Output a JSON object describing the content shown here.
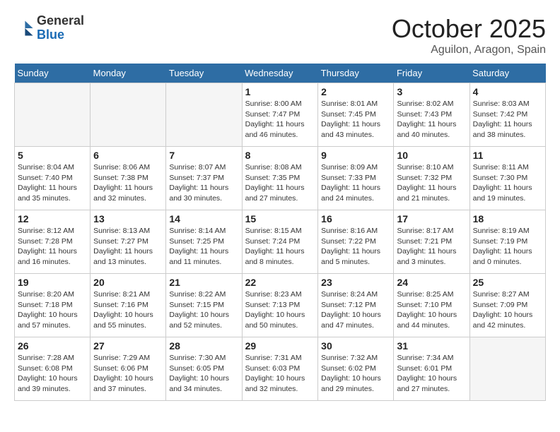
{
  "logo": {
    "general": "General",
    "blue": "Blue"
  },
  "title": "October 2025",
  "location": "Aguilon, Aragon, Spain",
  "weekdays": [
    "Sunday",
    "Monday",
    "Tuesday",
    "Wednesday",
    "Thursday",
    "Friday",
    "Saturday"
  ],
  "weeks": [
    [
      {
        "day": "",
        "info": ""
      },
      {
        "day": "",
        "info": ""
      },
      {
        "day": "",
        "info": ""
      },
      {
        "day": "1",
        "info": "Sunrise: 8:00 AM\nSunset: 7:47 PM\nDaylight: 11 hours\nand 46 minutes."
      },
      {
        "day": "2",
        "info": "Sunrise: 8:01 AM\nSunset: 7:45 PM\nDaylight: 11 hours\nand 43 minutes."
      },
      {
        "day": "3",
        "info": "Sunrise: 8:02 AM\nSunset: 7:43 PM\nDaylight: 11 hours\nand 40 minutes."
      },
      {
        "day": "4",
        "info": "Sunrise: 8:03 AM\nSunset: 7:42 PM\nDaylight: 11 hours\nand 38 minutes."
      }
    ],
    [
      {
        "day": "5",
        "info": "Sunrise: 8:04 AM\nSunset: 7:40 PM\nDaylight: 11 hours\nand 35 minutes."
      },
      {
        "day": "6",
        "info": "Sunrise: 8:06 AM\nSunset: 7:38 PM\nDaylight: 11 hours\nand 32 minutes."
      },
      {
        "day": "7",
        "info": "Sunrise: 8:07 AM\nSunset: 7:37 PM\nDaylight: 11 hours\nand 30 minutes."
      },
      {
        "day": "8",
        "info": "Sunrise: 8:08 AM\nSunset: 7:35 PM\nDaylight: 11 hours\nand 27 minutes."
      },
      {
        "day": "9",
        "info": "Sunrise: 8:09 AM\nSunset: 7:33 PM\nDaylight: 11 hours\nand 24 minutes."
      },
      {
        "day": "10",
        "info": "Sunrise: 8:10 AM\nSunset: 7:32 PM\nDaylight: 11 hours\nand 21 minutes."
      },
      {
        "day": "11",
        "info": "Sunrise: 8:11 AM\nSunset: 7:30 PM\nDaylight: 11 hours\nand 19 minutes."
      }
    ],
    [
      {
        "day": "12",
        "info": "Sunrise: 8:12 AM\nSunset: 7:28 PM\nDaylight: 11 hours\nand 16 minutes."
      },
      {
        "day": "13",
        "info": "Sunrise: 8:13 AM\nSunset: 7:27 PM\nDaylight: 11 hours\nand 13 minutes."
      },
      {
        "day": "14",
        "info": "Sunrise: 8:14 AM\nSunset: 7:25 PM\nDaylight: 11 hours\nand 11 minutes."
      },
      {
        "day": "15",
        "info": "Sunrise: 8:15 AM\nSunset: 7:24 PM\nDaylight: 11 hours\nand 8 minutes."
      },
      {
        "day": "16",
        "info": "Sunrise: 8:16 AM\nSunset: 7:22 PM\nDaylight: 11 hours\nand 5 minutes."
      },
      {
        "day": "17",
        "info": "Sunrise: 8:17 AM\nSunset: 7:21 PM\nDaylight: 11 hours\nand 3 minutes."
      },
      {
        "day": "18",
        "info": "Sunrise: 8:19 AM\nSunset: 7:19 PM\nDaylight: 11 hours\nand 0 minutes."
      }
    ],
    [
      {
        "day": "19",
        "info": "Sunrise: 8:20 AM\nSunset: 7:18 PM\nDaylight: 10 hours\nand 57 minutes."
      },
      {
        "day": "20",
        "info": "Sunrise: 8:21 AM\nSunset: 7:16 PM\nDaylight: 10 hours\nand 55 minutes."
      },
      {
        "day": "21",
        "info": "Sunrise: 8:22 AM\nSunset: 7:15 PM\nDaylight: 10 hours\nand 52 minutes."
      },
      {
        "day": "22",
        "info": "Sunrise: 8:23 AM\nSunset: 7:13 PM\nDaylight: 10 hours\nand 50 minutes."
      },
      {
        "day": "23",
        "info": "Sunrise: 8:24 AM\nSunset: 7:12 PM\nDaylight: 10 hours\nand 47 minutes."
      },
      {
        "day": "24",
        "info": "Sunrise: 8:25 AM\nSunset: 7:10 PM\nDaylight: 10 hours\nand 44 minutes."
      },
      {
        "day": "25",
        "info": "Sunrise: 8:27 AM\nSunset: 7:09 PM\nDaylight: 10 hours\nand 42 minutes."
      }
    ],
    [
      {
        "day": "26",
        "info": "Sunrise: 7:28 AM\nSunset: 6:08 PM\nDaylight: 10 hours\nand 39 minutes."
      },
      {
        "day": "27",
        "info": "Sunrise: 7:29 AM\nSunset: 6:06 PM\nDaylight: 10 hours\nand 37 minutes."
      },
      {
        "day": "28",
        "info": "Sunrise: 7:30 AM\nSunset: 6:05 PM\nDaylight: 10 hours\nand 34 minutes."
      },
      {
        "day": "29",
        "info": "Sunrise: 7:31 AM\nSunset: 6:03 PM\nDaylight: 10 hours\nand 32 minutes."
      },
      {
        "day": "30",
        "info": "Sunrise: 7:32 AM\nSunset: 6:02 PM\nDaylight: 10 hours\nand 29 minutes."
      },
      {
        "day": "31",
        "info": "Sunrise: 7:34 AM\nSunset: 6:01 PM\nDaylight: 10 hours\nand 27 minutes."
      },
      {
        "day": "",
        "info": ""
      }
    ]
  ]
}
